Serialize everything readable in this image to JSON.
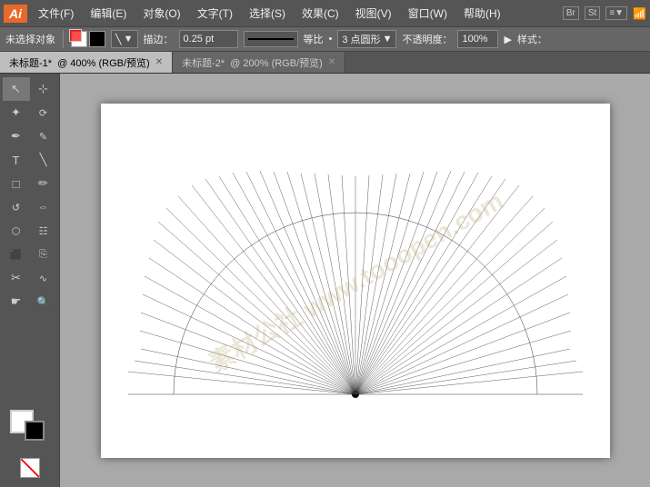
{
  "app": {
    "logo": "Ai",
    "logo_color": "#e8692a"
  },
  "menubar": {
    "items": [
      {
        "label": "文件(F)"
      },
      {
        "label": "编辑(E)"
      },
      {
        "label": "对象(O)"
      },
      {
        "label": "文字(T)"
      },
      {
        "label": "选择(S)"
      },
      {
        "label": "效果(C)"
      },
      {
        "label": "视图(V)"
      },
      {
        "label": "窗口(W)"
      },
      {
        "label": "帮助(H)"
      }
    ]
  },
  "optionsbar": {
    "no_selection_label": "未选择对象",
    "stroke_label": "描边：",
    "stroke_value": "0.25",
    "stroke_unit": "pt",
    "ratio_label": "等比",
    "circle_label": "3 点圆形",
    "opacity_label": "不透明度：",
    "opacity_value": "100%",
    "style_label": "样式："
  },
  "tabs": [
    {
      "label": "未标题-1*",
      "detail": "@ 400% (RGB/预览)",
      "active": true
    },
    {
      "label": "未标题-2*",
      "detail": "@ 200% (RGB/预览)",
      "active": false
    }
  ],
  "toolbar": {
    "tools": [
      [
        {
          "icon": "↖",
          "name": "selection-tool"
        },
        {
          "icon": "⊹",
          "name": "direct-selection-tool"
        }
      ],
      [
        {
          "icon": "✦",
          "name": "magic-wand-tool"
        },
        {
          "icon": "⟳",
          "name": "lasso-tool"
        }
      ],
      [
        {
          "icon": "✏",
          "name": "pen-tool"
        },
        {
          "icon": "+",
          "name": "add-anchor-tool"
        }
      ],
      [
        {
          "icon": "T",
          "name": "type-tool"
        },
        {
          "icon": "╲",
          "name": "line-tool"
        }
      ],
      [
        {
          "icon": "□",
          "name": "rect-tool"
        },
        {
          "icon": "✎",
          "name": "pencil-tool"
        }
      ],
      [
        {
          "icon": "↺",
          "name": "rotate-tool"
        },
        {
          "icon": "⇔",
          "name": "reflect-tool"
        }
      ],
      [
        {
          "icon": "⬡",
          "name": "warp-tool"
        },
        {
          "icon": "☷",
          "name": "free-transform-tool"
        }
      ],
      [
        {
          "icon": "⬛",
          "name": "symbol-sprayer-tool"
        },
        {
          "icon": "⎘",
          "name": "column-graph-tool"
        }
      ],
      [
        {
          "icon": "✂",
          "name": "scissors-tool"
        },
        {
          "icon": "∿",
          "name": "eraser-tool"
        }
      ],
      [
        {
          "icon": "☛",
          "name": "hand-tool"
        },
        {
          "icon": "🔍",
          "name": "zoom-tool"
        }
      ]
    ],
    "fg_color": "white",
    "bg_color": "black"
  },
  "canvas": {
    "watermark": "素材公社 www.tooopen.com"
  }
}
